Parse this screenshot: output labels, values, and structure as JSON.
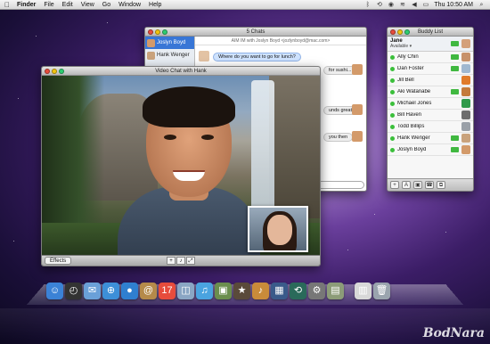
{
  "menubar": {
    "apple_icon": "apple-logo-icon",
    "items": [
      "Finder",
      "File",
      "Edit",
      "View",
      "Go",
      "Window",
      "Help"
    ],
    "clock": "Thu 10:50 AM"
  },
  "chats_window": {
    "title": "5 Chats",
    "contacts": [
      {
        "name": "Joslyn Boyd",
        "selected": true,
        "avatar_color": "#d39a6a"
      },
      {
        "name": "Hank Wenger",
        "selected": false,
        "avatar_color": "#c9a27c"
      }
    ],
    "header_text": "AIM IM with Joslyn Boyd <jozlynboyd@mac.com>",
    "messages": [
      {
        "from": "me",
        "text": "Where do you want to go for lunch?"
      },
      {
        "from": "them",
        "text": "for sushi..."
      },
      {
        "from": "them",
        "text": "unds great"
      },
      {
        "from": "them",
        "text": "you then"
      }
    ]
  },
  "buddy_list": {
    "title": "Buddy List",
    "me": {
      "name": "Jane",
      "status": "Available"
    },
    "buddies": [
      {
        "name": "Ally Chin",
        "video": true,
        "avatar_color": "#c7916a"
      },
      {
        "name": "Dan Foster",
        "video": true,
        "avatar_color": "#a0b8d0"
      },
      {
        "name": "Jill Bell",
        "video": false,
        "avatar_color": "#e07b2a"
      },
      {
        "name": "Aki Watanabe",
        "video": true,
        "avatar_color": "#c47a3a"
      },
      {
        "name": "Michael Jones",
        "video": false,
        "avatar_color": "#2f9a4a"
      },
      {
        "name": "Bill Haven",
        "video": false,
        "avatar_color": "#6e6e6e"
      },
      {
        "name": "Todd Billips",
        "video": false,
        "avatar_color": "#9aa0a8"
      },
      {
        "name": "Hank Wenger",
        "video": true,
        "avatar_color": "#c9a27c"
      },
      {
        "name": "Joslyn Boyd",
        "video": true,
        "avatar_color": "#d39a6a"
      }
    ],
    "footer_buttons": [
      "+",
      "A",
      "camera",
      "phone",
      "share"
    ]
  },
  "video_window": {
    "title": "Video Chat with Hank",
    "effects_label": "Effects"
  },
  "dock": {
    "apps": [
      {
        "name": "finder-icon",
        "glyph": "☺",
        "color": "#3b82d6"
      },
      {
        "name": "dashboard-icon",
        "glyph": "◴",
        "color": "#333"
      },
      {
        "name": "mail-icon",
        "glyph": "✉",
        "color": "#6aa0d8"
      },
      {
        "name": "safari-icon",
        "glyph": "⊕",
        "color": "#3d8fd8"
      },
      {
        "name": "ichat-icon",
        "glyph": "●",
        "color": "#2f7fd0"
      },
      {
        "name": "address-book-icon",
        "glyph": "@",
        "color": "#b58a4a"
      },
      {
        "name": "ical-icon",
        "glyph": "17",
        "color": "#e74c3c"
      },
      {
        "name": "preview-icon",
        "glyph": "◫",
        "color": "#8aa6c4"
      },
      {
        "name": "itunes-icon",
        "glyph": "♫",
        "color": "#4aa3df"
      },
      {
        "name": "iphoto-icon",
        "glyph": "▣",
        "color": "#6b8e4e"
      },
      {
        "name": "imovie-icon",
        "glyph": "★",
        "color": "#5a4a3a"
      },
      {
        "name": "garageband-icon",
        "glyph": "♪",
        "color": "#c98b3a"
      },
      {
        "name": "spaces-icon",
        "glyph": "▦",
        "color": "#3a5a8a"
      },
      {
        "name": "time-machine-icon",
        "glyph": "⟲",
        "color": "#2a6a5a"
      },
      {
        "name": "system-preferences-icon",
        "glyph": "⚙",
        "color": "#777"
      },
      {
        "name": "photo-stack-icon",
        "glyph": "▤",
        "color": "#8c9c78"
      },
      {
        "name": "documents-stack-icon",
        "glyph": "▥",
        "color": "#d8d8d8"
      },
      {
        "name": "trash-icon",
        "glyph": "🗑",
        "color": "#9aa4ae"
      }
    ]
  },
  "watermark": "BodNara"
}
